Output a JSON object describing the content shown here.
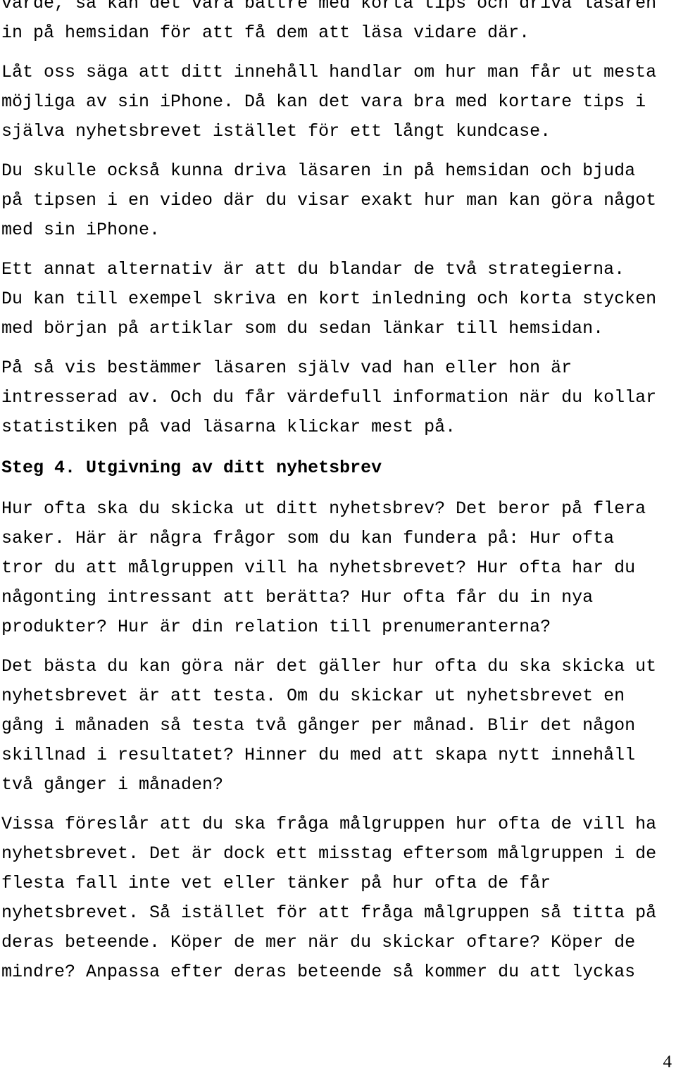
{
  "document": {
    "page_number": "4",
    "language": "sv",
    "blocks": [
      {
        "id": "para-1",
        "type": "paragraph",
        "text": "värde, så kan det vara bättre med korta tips och driva läsaren\nin på hemsidan för att få dem att läsa vidare där."
      },
      {
        "id": "para-2",
        "type": "paragraph",
        "text": "Låt oss säga att ditt innehåll handlar om hur man får ut mesta\nmöjliga av sin iPhone. Då kan det vara bra med kortare tips i\nsjälva nyhetsbrevet istället för ett långt kundcase."
      },
      {
        "id": "para-3",
        "type": "paragraph",
        "text": "Du skulle också kunna driva läsaren in på hemsidan och bjuda\npå tipsen i en video där du visar exakt hur man kan göra något\nmed sin iPhone."
      },
      {
        "id": "para-4",
        "type": "paragraph",
        "text": "Ett annat alternativ är att du blandar de två strategierna.\nDu kan till exempel skriva en kort inledning och korta stycken\nmed början på artiklar som du sedan länkar till hemsidan."
      },
      {
        "id": "para-5",
        "type": "paragraph",
        "text": "På så vis bestämmer läsaren själv vad han eller hon är\nintresserad av. Och du får värdefull information när du kollar\nstatistiken på vad läsarna klickar mest på."
      },
      {
        "id": "heading-steg-4",
        "type": "heading",
        "text": "Steg 4. Utgivning av ditt nyhetsbrev"
      },
      {
        "id": "para-6",
        "type": "paragraph",
        "text": "Hur ofta ska du skicka ut ditt nyhetsbrev? Det beror på flera\nsaker. Här är några frågor som du kan fundera på: Hur ofta\ntror du att målgruppen vill ha nyhetsbrevet? Hur ofta har du\nnågonting intressant att berätta? Hur ofta får du in nya\nprodukter? Hur är din relation till prenumeranterna?"
      },
      {
        "id": "para-7",
        "type": "paragraph",
        "text": "Det bästa du kan göra när det gäller hur ofta du ska skicka ut\nnyhetsbrevet är att testa. Om du skickar ut nyhetsbrevet en\ngång i månaden så testa två gånger per månad. Blir det någon\nskillnad i resultatet? Hinner du med att skapa nytt innehåll\ntvå gånger i månaden?"
      },
      {
        "id": "para-8",
        "type": "paragraph",
        "text": "Vissa föreslår att du ska fråga målgruppen hur ofta de vill ha\nnyhetsbrevet. Det är dock ett misstag eftersom målgruppen i de\nflesta fall inte vet eller tänker på hur ofta de får\nnyhetsbrevet. Så istället för att fråga målgruppen så titta på\nderas beteende. Köper de mer när du skickar oftare? Köper de\nmindre? Anpassa efter deras beteende så kommer du att lyckas"
      }
    ]
  }
}
